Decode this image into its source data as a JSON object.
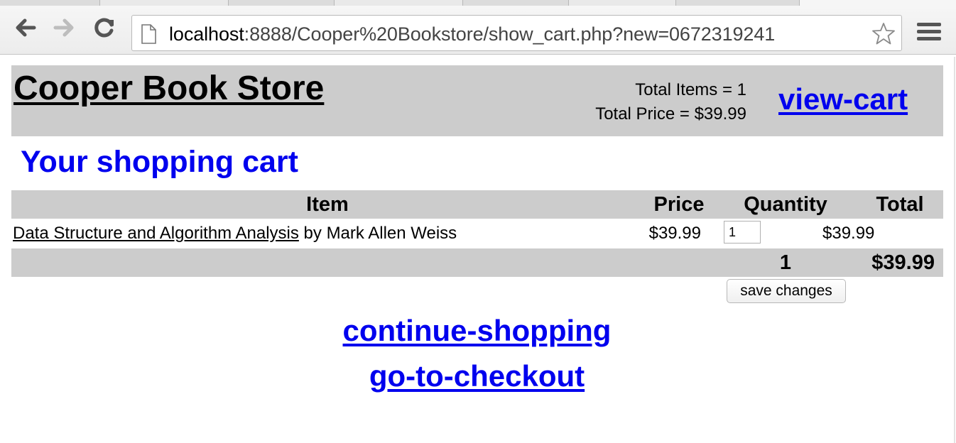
{
  "browser": {
    "url_host": "localhost",
    "url_rest": ":8888/Cooper%20Bookstore/show_cart.php?new=0672319241"
  },
  "header": {
    "store_title": "Cooper Book Store",
    "total_items": "Total Items = 1",
    "total_price": "Total Price = $39.99",
    "view_cart_label": "view-cart"
  },
  "cart": {
    "heading": "Your shopping cart",
    "columns": {
      "item": "Item",
      "price": "Price",
      "quantity": "Quantity",
      "total": "Total"
    },
    "rows": [
      {
        "title": "Data Structure and Algorithm Analysis",
        "author_text": "by Mark Allen Weiss",
        "price": "$39.99",
        "quantity": "1",
        "total": "$39.99"
      }
    ],
    "totals": {
      "quantity": "1",
      "total": "$39.99"
    },
    "save_changes_label": "save changes"
  },
  "links": {
    "continue_shopping": "continue-shopping",
    "checkout": "go-to-checkout"
  }
}
